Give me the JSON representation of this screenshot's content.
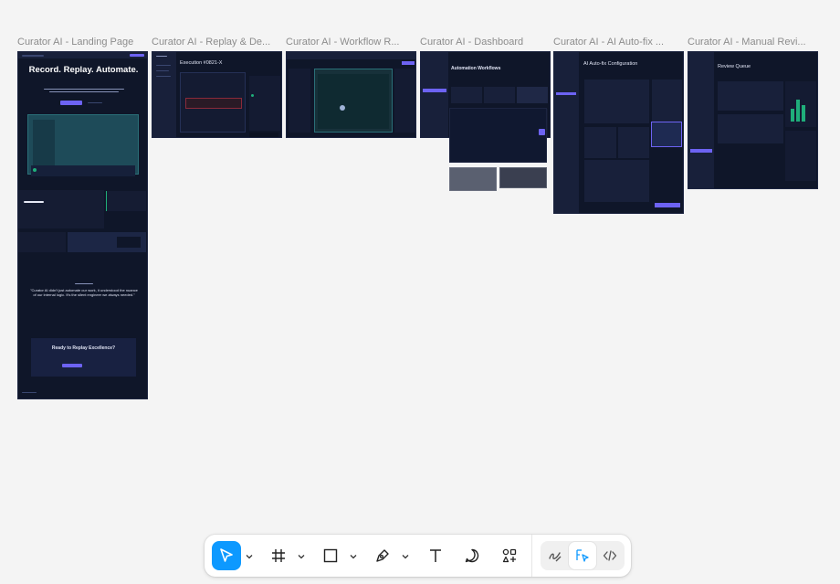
{
  "canvas": {
    "background": "#f4f4f4"
  },
  "frames": [
    {
      "label": "Curator AI - Landing Page"
    },
    {
      "label": "Curator AI - Replay & De..."
    },
    {
      "label": "Curator AI - Workflow R..."
    },
    {
      "label": "Curator AI - Dashboard"
    },
    {
      "label": "Curator AI - AI Auto-fix ..."
    },
    {
      "label": "Curator AI - Manual Revi..."
    }
  ],
  "landing": {
    "hero_title": "Record. Replay. Automate.",
    "quote": "\"Curator AI didn't just automate our work, it understood the nuance of our internal logic. It's the silent engineer we always needed.\"",
    "cta_title": "Ready to Replay Excellence?"
  },
  "replay": {
    "execution_title": "Execution #0821-X"
  },
  "dashboard": {
    "title": "Automation Workflows"
  },
  "autofix": {
    "title": "AI Auto-fix Configuration"
  },
  "manual": {
    "title": "Review Queue"
  },
  "toolbar": {
    "tools": [
      {
        "name": "move-tool",
        "icon": "cursor-arrow-icon",
        "active": true
      },
      {
        "name": "frame-tool",
        "icon": "frame-hash-icon"
      },
      {
        "name": "shape-tool",
        "icon": "rectangle-icon"
      },
      {
        "name": "pen-tool",
        "icon": "pen-nib-icon"
      },
      {
        "name": "text-tool",
        "icon": "text-t-icon"
      },
      {
        "name": "comment-tool",
        "icon": "speech-bubble-icon"
      },
      {
        "name": "actions-tool",
        "icon": "components-plus-icon"
      },
      {
        "name": "draw-mode",
        "icon": "pencil-squiggle-icon"
      },
      {
        "name": "design-mode",
        "icon": "design-cursor-icon",
        "selected": true
      },
      {
        "name": "dev-mode",
        "icon": "code-brackets-icon"
      }
    ],
    "accent_color": "#0d99ff"
  }
}
